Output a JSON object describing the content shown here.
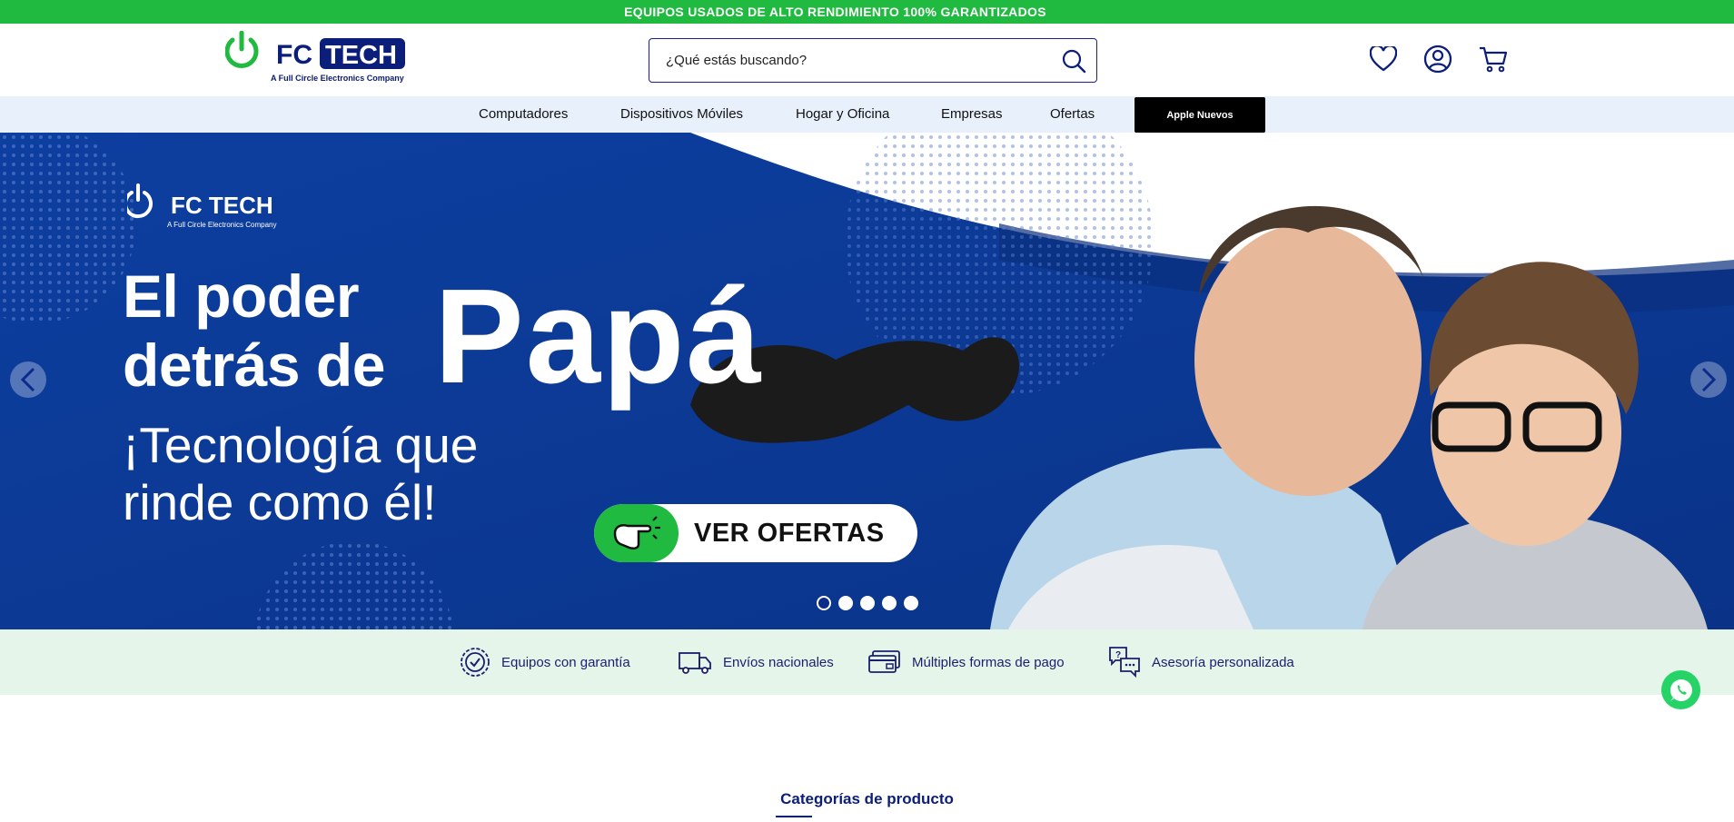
{
  "topbar": {
    "text": "EQUIPOS USADOS DE ALTO RENDIMIENTO 100% GARANTIZADOS"
  },
  "header": {
    "logo_text": "FC TECH",
    "logo_sub": "A Full Circle Electronics Company",
    "search_placeholder": "¿Qué estás buscando?",
    "icons": [
      "search-icon",
      "heart-icon",
      "user-icon",
      "cart-icon"
    ]
  },
  "nav": {
    "items": [
      "Computadores",
      "Dispositivos Móviles",
      "Hogar y Oficina",
      "Empresas",
      "Ofertas"
    ],
    "apple": "Apple Nuevos"
  },
  "hero": {
    "brand": "FC TECH",
    "brand_sub": "A Full Circle Electronics Company",
    "line1": "El poder",
    "line2": "detrás de",
    "big": "Papá",
    "tag1": "¡Tecnología que",
    "tag2": "rinde como él!",
    "cta": "VER OFERTAS",
    "slides": 5,
    "active_slide": 1
  },
  "features": [
    {
      "icon": "badge-check-icon",
      "label": "Equipos con garantía"
    },
    {
      "icon": "truck-icon",
      "label": "Envíos nacionales"
    },
    {
      "icon": "credit-card-icon",
      "label": "Múltiples formas de pago"
    },
    {
      "icon": "chat-question-icon",
      "label": "Asesoría personalizada"
    }
  ],
  "section": {
    "title": "Categorías de producto"
  },
  "colors": {
    "green": "#1fba3f",
    "navy": "#0b1e7a",
    "hero_blue": "#0c3f9a",
    "nav_bg": "#e8f0fb",
    "features_bg": "#e6f5ea"
  }
}
